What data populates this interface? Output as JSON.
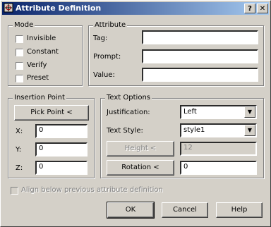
{
  "window": {
    "title": "Attribute Definition",
    "help_glyph": "?",
    "close_glyph": "✕"
  },
  "mode": {
    "legend": "Mode",
    "options": [
      "Invisible",
      "Constant",
      "Verify",
      "Preset"
    ]
  },
  "attribute": {
    "legend": "Attribute",
    "tag_label": "Tag:",
    "tag_value": "",
    "prompt_label": "Prompt:",
    "prompt_value": "",
    "value_label": "Value:",
    "value_value": ""
  },
  "insertion": {
    "legend": "Insertion Point",
    "pick_point": "Pick Point <",
    "x_label": "X:",
    "x_value": "0",
    "y_label": "Y:",
    "y_value": "0",
    "z_label": "Z:",
    "z_value": "0"
  },
  "text_options": {
    "legend": "Text Options",
    "justification_label": "Justification:",
    "justification_value": "Left",
    "style_label": "Text Style:",
    "style_value": "style1",
    "height_button": "Height <",
    "height_value": "12",
    "rotation_button": "Rotation <",
    "rotation_value": "0"
  },
  "align_label": "Align below previous attribute definition",
  "buttons": {
    "ok": "OK",
    "cancel": "Cancel",
    "help": "Help"
  }
}
